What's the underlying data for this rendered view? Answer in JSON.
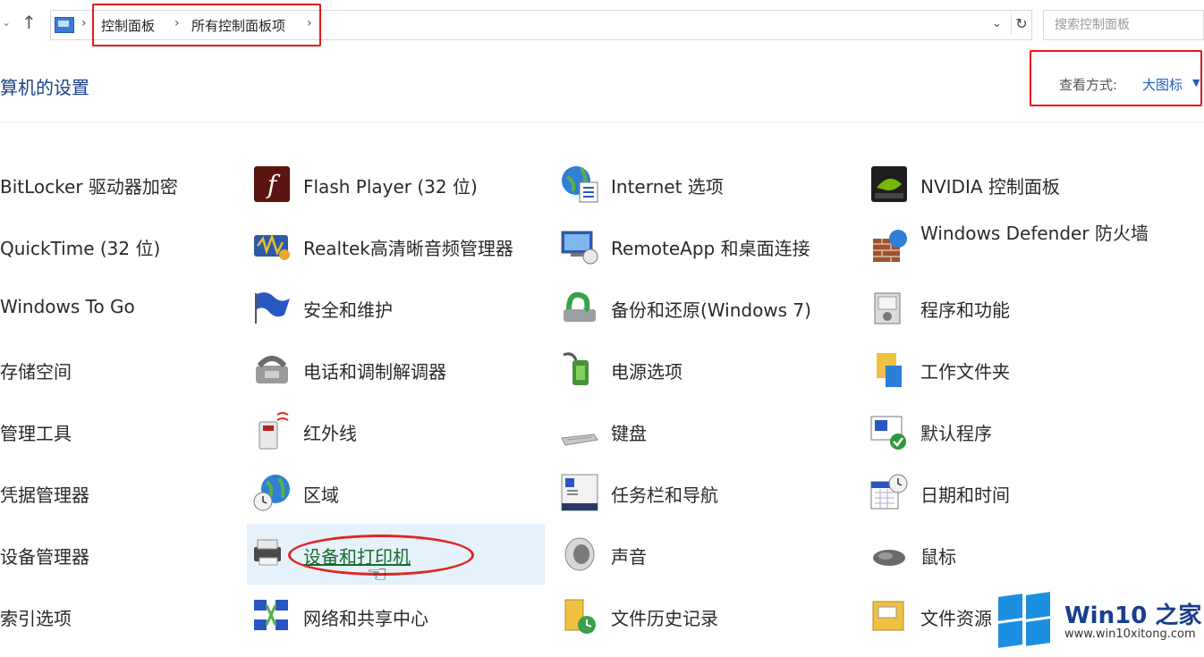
{
  "address_bar": {
    "breadcrumb": [
      "控制面板",
      "所有控制面板项"
    ],
    "search_placeholder": "搜索控制面板"
  },
  "header": {
    "title": "算机的设置",
    "view_by_label": "查看方式:",
    "view_by_value": "大图标"
  },
  "items": [
    [
      "BitLocker 驱动器加密",
      "Flash Player (32 位)",
      "Internet 选项",
      "NVIDIA 控制面板"
    ],
    [
      "QuickTime (32 位)",
      "Realtek高清晰音频管理器",
      "RemoteApp 和桌面连接",
      "Windows Defender 防火墙"
    ],
    [
      "Windows To Go",
      "安全和维护",
      "备份和还原(Windows 7)",
      "程序和功能"
    ],
    [
      "存储空间",
      "电话和调制解调器",
      "电源选项",
      "工作文件夹"
    ],
    [
      "管理工具",
      "红外线",
      "键盘",
      "默认程序"
    ],
    [
      "凭据管理器",
      "区域",
      "任务栏和导航",
      "日期和时间"
    ],
    [
      "设备管理器",
      "设备和打印机",
      "声音",
      "鼠标"
    ],
    [
      "索引选项",
      "网络和共享中心",
      "文件历史记录",
      "文件资源"
    ]
  ],
  "watermark": {
    "title": "Win10 之家",
    "url": "www.win10xitong.com"
  },
  "colors": {
    "annotation_red": "#e21a1a",
    "link_blue": "#1a5fc0",
    "hover_bg": "#e5f1fb"
  }
}
